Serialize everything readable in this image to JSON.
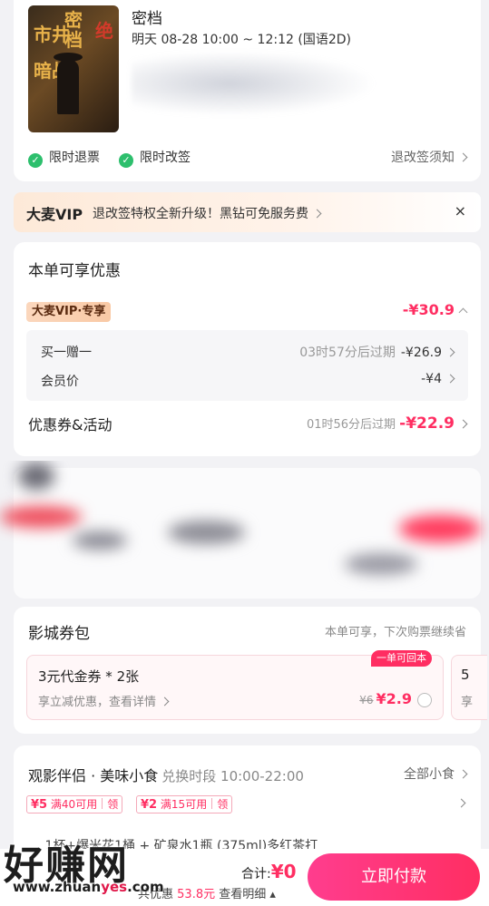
{
  "movie": {
    "poster_text": [
      "市井",
      "暗战",
      "密",
      "档",
      "绝"
    ],
    "title": "密档",
    "showtime": "明天 08-28 10:00 ~ 12:12 (国语2D)",
    "badges": [
      "限时退票",
      "限时改签"
    ],
    "policy_link": "退改签须知"
  },
  "vip_banner": {
    "brand": "大麦VIP",
    "text": "退改签特权全新升级！黑钻可免服务费",
    "close": "×"
  },
  "discounts": {
    "title": "本单可享优惠",
    "vip_tag": "大麦VIP·专享",
    "vip_amount": "-¥30.9",
    "items": [
      {
        "label": "买一赠一",
        "expiry": "03时57分后过期",
        "amount": "-¥26.9"
      },
      {
        "label": "会员价",
        "expiry": "",
        "amount": "-¥4"
      }
    ],
    "coupons": {
      "label": "优惠券&活动",
      "expiry": "01时56分后过期",
      "amount": "-¥22.9"
    }
  },
  "coupon_pack": {
    "title": "影城券包",
    "hint": "本单可享，下次购票继续省",
    "card": {
      "name": "3元代金券 * 2张",
      "desc": "享立减优惠，查看详情",
      "tag": "一单可回本",
      "orig_price": "¥6",
      "price": "¥2.9"
    },
    "next_card": {
      "name": "5",
      "desc": "享"
    }
  },
  "snacks": {
    "title": "观影伴侣 · 美味小食",
    "time": "兑换时段 10:00-22:00",
    "all": "全部小食",
    "coupons": [
      {
        "amount": "¥5",
        "cond": "满40可用",
        "action": "领"
      },
      {
        "amount": "¥2",
        "cond": "满15可用",
        "action": "领"
      }
    ],
    "item_line": "… 1杯+爆米花1桶 + 矿泉水1瓶 (375ml)多红茶打"
  },
  "bottom": {
    "total_label": "合计:",
    "total_value": "¥0",
    "saved_label": "共优惠",
    "saved_value": "53.8元",
    "detail": "查看明细",
    "pay": "立即付款"
  },
  "watermark": {
    "text": "好赚网",
    "url_a": "www.zhuan",
    "url_b": "yes",
    "url_c": ".com"
  }
}
